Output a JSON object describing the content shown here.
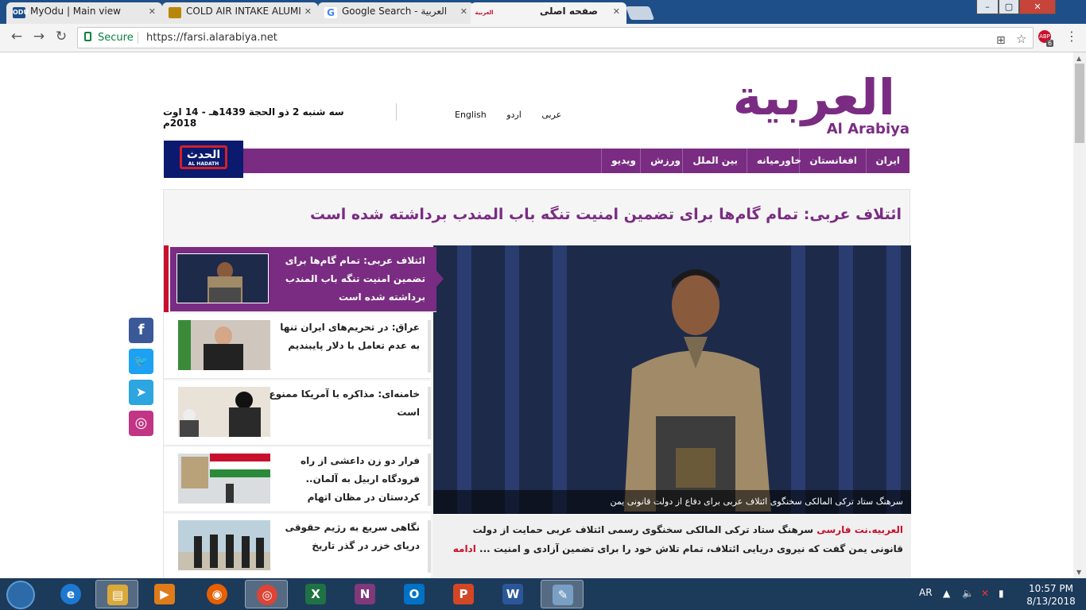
{
  "browser": {
    "tabs": [
      {
        "label": "MyOdu | Main view",
        "icon": "ODU",
        "icon_color": "#1a4f8b"
      },
      {
        "label": "COLD AIR INTAKE ALUMI",
        "icon": "",
        "icon_color": "#b8860b"
      },
      {
        "label": "Google Search - العربية",
        "icon": "G",
        "icon_color": "#4285f4"
      },
      {
        "label": "صفحه اصلی",
        "icon": "العربية",
        "icon_color": "#7a2c82"
      }
    ],
    "secure_label": "Secure",
    "url": "https://farsi.alarabiya.net",
    "ext_badge": "6"
  },
  "site": {
    "logo_ar": "العربية",
    "logo_en": "Al Arabiya",
    "date": "سه شنبه 2 ذو الحجة 1439هـ - 14 اوت 2018م",
    "languages": [
      "English",
      "اردو",
      "عربی"
    ],
    "hadath_ar": "الحدث",
    "hadath_en": "AL HADATH",
    "nav": [
      "ایران",
      "افغانستان",
      "خاورمیانه",
      "بین الملل",
      "ورزش",
      "ویدیو"
    ],
    "headline": "ائتلاف عربی: تمام گام‌ها برای تضمین امنیت تنگه باب المندب برداشته شده است",
    "caption": "سرهنگ ستاد ترکی المالکی سخنگوی ائتلاف عربی برای دفاع از دولت قانونی یمن",
    "summary_source": "العربیه.نت فارسی",
    "summary_text": " سرهنگ ستاد ترکی المالکی سخنگوی رسمی ائتلاف عربی حمایت از دولت قانونی یمن گفت که نیروی دریایی ائتلاف، تمام تلاش خود را برای تضمین آزادی و امنیت ... ",
    "summary_more": "ادامه",
    "side_items": [
      {
        "text": "ائتلاف عربی: تمام گام‌ها برای تضمین امنیت تنگه باب المندب برداشته شده است"
      },
      {
        "text": "عراق: در تحریم‌های ایران تنها به عدم تعامل با دلار پایبندیم"
      },
      {
        "text": "خامنه‌ای: مذاکره با آمریکا ممنوع است"
      },
      {
        "text": "فرار دو زن داعشی از راه فرودگاه اربیل به آلمان.. کردستان در مظان اتهام"
      },
      {
        "text": "نگاهی سریع به رژیم حقوقی دریای خزر در گذر تاریخ"
      }
    ],
    "social": [
      {
        "name": "facebook",
        "glyph": "f",
        "color": "#3b5998"
      },
      {
        "name": "twitter",
        "glyph": "t",
        "color": "#1da1f2"
      },
      {
        "name": "telegram",
        "glyph": "➤",
        "color": "#2ca5e0"
      },
      {
        "name": "instagram",
        "glyph": "◎",
        "color": "#c13584"
      }
    ]
  },
  "taskbar": {
    "apps": [
      {
        "name": "ie",
        "glyph": "e",
        "color": "#1e78d0"
      },
      {
        "name": "explorer",
        "glyph": "▤",
        "color": "#d9a93a"
      },
      {
        "name": "media-player",
        "glyph": "▶",
        "color": "#e07b1a"
      },
      {
        "name": "firefox",
        "glyph": "◉",
        "color": "#e66000"
      },
      {
        "name": "chrome",
        "glyph": "◎",
        "color": "#db4437"
      },
      {
        "name": "excel",
        "glyph": "X",
        "color": "#1f7244"
      },
      {
        "name": "onenote",
        "glyph": "N",
        "color": "#80397b"
      },
      {
        "name": "outlook",
        "glyph": "O",
        "color": "#0072c6"
      },
      {
        "name": "powerpoint",
        "glyph": "P",
        "color": "#d24726"
      },
      {
        "name": "word",
        "glyph": "W",
        "color": "#2b579a"
      },
      {
        "name": "paint",
        "glyph": "✎",
        "color": "#7a9fc4"
      }
    ],
    "lang": "AR",
    "time": "10:57 PM",
    "date": "8/13/2018"
  }
}
